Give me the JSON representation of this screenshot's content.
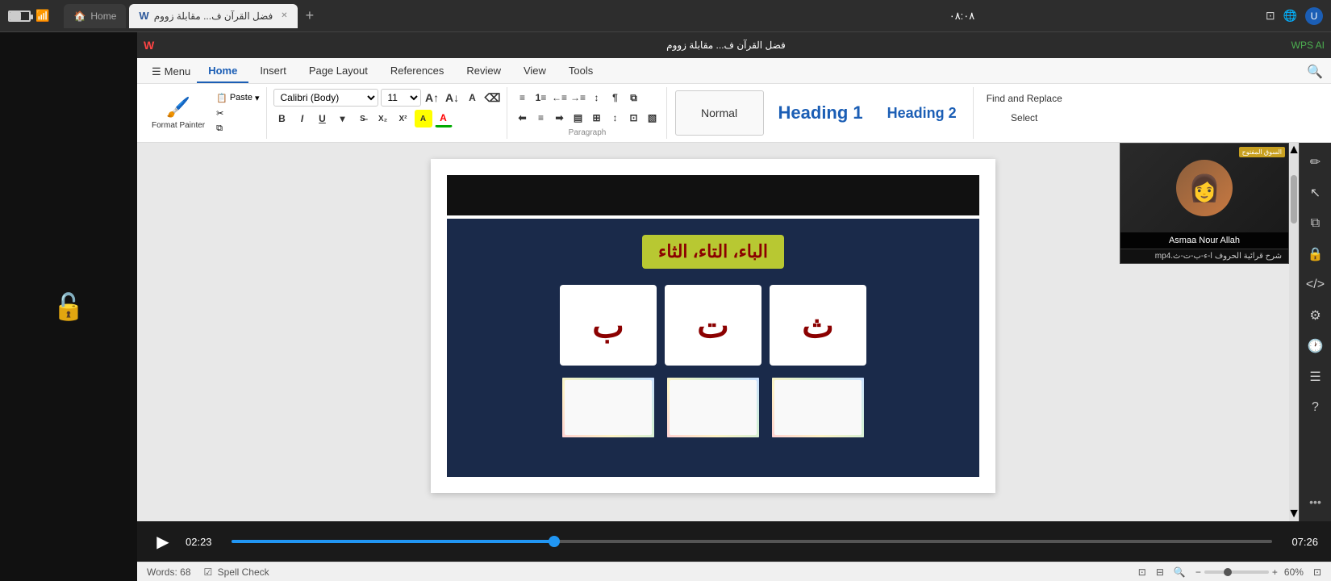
{
  "browser": {
    "tabs": [
      {
        "id": "home",
        "label": "Home",
        "favicon": "🏠",
        "active": false
      },
      {
        "id": "doc",
        "label": "فضل القرآن ف... مقابلة زووم",
        "favicon": "W",
        "active": true,
        "closable": true
      }
    ],
    "add_tab_label": "+",
    "time": "٠٨:٠٨",
    "icons": [
      "🔋",
      "📶"
    ]
  },
  "wps_header": {
    "logo": "W",
    "title": "WPS AI",
    "doc_title": "فضل القرآن ف... مقابلة زووم"
  },
  "ribbon": {
    "tabs": [
      "Menu",
      "Home",
      "Insert",
      "Page Layout",
      "References",
      "Review",
      "View",
      "Tools"
    ],
    "active_tab": "Home",
    "clipboard": {
      "format_painter_label": "Format Painter",
      "paste_label": "Paste"
    },
    "font": {
      "name": "Calibri (Body)",
      "size": "11"
    },
    "styles": {
      "normal": "Normal",
      "heading1": "Heading 1",
      "heading2": "Heading 2"
    },
    "editing": {
      "find_replace_label": "Find and Replace",
      "select_label": "Select"
    }
  },
  "video1": {
    "top_bar_visible": false
  },
  "video2": {
    "arabic_title": "الباء، التاء، الثاء",
    "letter1": "ث",
    "letter2": "ت",
    "letter3": "ب"
  },
  "controls": {
    "play_icon": "▶",
    "current_time": "02:23",
    "total_time": "07:26",
    "progress_percent": 31
  },
  "status_bar": {
    "words_label": "Words:",
    "word_count": "68",
    "spell_check_label": "Spell Check",
    "zoom_percent": "60%"
  },
  "right_sidebar": {
    "icons": [
      "✏️",
      "⬆",
      "⧉",
      "🔒",
      "</>",
      "⚙",
      "🕐",
      "☰",
      "?"
    ]
  },
  "presenter": {
    "name": "Asmaa Nour Allah",
    "logo": "السوق المفتوح",
    "title": "شرح قرائية الحروف ا-ء-ب-ت-ث.mp4"
  },
  "lock_icon": "🔓"
}
